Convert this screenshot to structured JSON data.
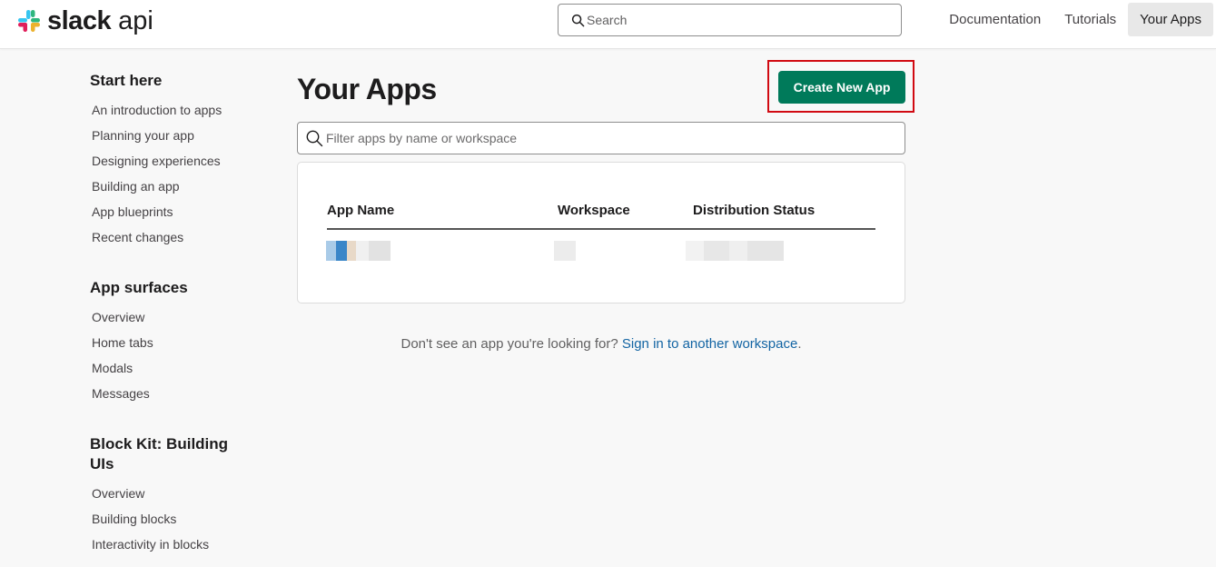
{
  "header": {
    "logo_text": "slack",
    "logo_sub": "api",
    "search_placeholder": "Search",
    "nav": [
      {
        "label": "Documentation",
        "active": false
      },
      {
        "label": "Tutorials",
        "active": false
      },
      {
        "label": "Your Apps",
        "active": true
      }
    ]
  },
  "sidebar": {
    "sections": [
      {
        "heading": "Start here",
        "items": [
          "An introduction to apps",
          "Planning your app",
          "Designing experiences",
          "Building an app",
          "App blueprints",
          "Recent changes"
        ]
      },
      {
        "heading": "App surfaces",
        "items": [
          "Overview",
          "Home tabs",
          "Modals",
          "Messages"
        ]
      },
      {
        "heading": "Block Kit: Building UIs",
        "items": [
          "Overview",
          "Building blocks",
          "Interactivity in blocks"
        ]
      }
    ]
  },
  "main": {
    "title": "Your Apps",
    "create_button": "Create New App",
    "filter_placeholder": "Filter apps by name or workspace",
    "table": {
      "headers": [
        "App Name",
        "Workspace",
        "Distribution Status"
      ]
    },
    "footnote": {
      "text": "Don't see an app you're looking for? ",
      "link": "Sign in to another workspace",
      "end": "."
    }
  },
  "colors": {
    "accent_green": "#007a5a",
    "link_blue": "#1264a3",
    "highlight_red": "#d10a12"
  }
}
